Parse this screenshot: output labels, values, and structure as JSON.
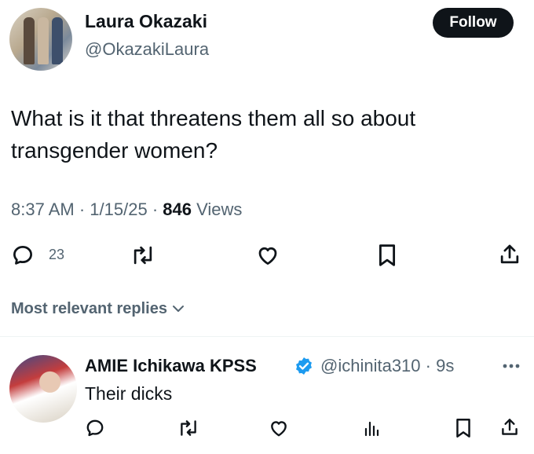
{
  "tweet": {
    "author_name": "Laura Okazaki",
    "author_handle": "@OkazakiLaura",
    "follow_label": "Follow",
    "text": "What is it that threatens them all so about transgender women?",
    "time": "8:37 AM",
    "date": "1/15/25",
    "views_count": "846",
    "views_label": "Views",
    "reply_count": "23"
  },
  "replies_header": {
    "label": "Most relevant replies"
  },
  "reply": {
    "author_name": "AMIE Ichikawa KPSS",
    "author_handle": "@ichinita310",
    "age": "9s",
    "text": "Their dicks"
  },
  "icons": {
    "reply": "reply-icon",
    "retweet": "retweet-icon",
    "like": "heart-icon",
    "bookmark": "bookmark-icon",
    "share": "share-icon",
    "verified": "verified-badge-icon",
    "views": "views-icon",
    "more": "more-icon"
  },
  "colors": {
    "text": "#0f1419",
    "secondary": "#536471",
    "verified": "#1d9bf0",
    "follow_bg": "#0f1419"
  }
}
